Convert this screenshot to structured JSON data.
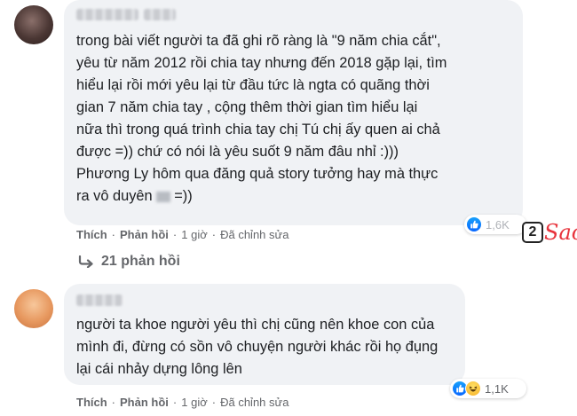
{
  "comments": [
    {
      "author": "",
      "text": "trong bài viết người ta đã ghi rõ ràng là \"9 năm chia cắt\",\nyêu từ năm 2012 rồi chia tay nhưng đến 2018 gặp lại, tìm\nhiểu lại rồi mới yêu lại từ đầu tức là ngta có quãng thời\ngian 7 năm chia tay , cộng thêm thời gian tìm hiểu lại\nnữa thì trong quá trình chia tay chị Tú chị ấy quen ai chả\nđược =)) chứ có nói là yêu suốt 9 năm đâu nhỉ :)))\nPhương Ly hôm qua đăng quả story tưởng hay mà thực\nra vô duyên",
      "text_tail": "=))",
      "like_label": "Thích",
      "reply_label": "Phản hồi",
      "time": "1 giờ",
      "edited": "Đã chỉnh sửa",
      "reaction_count": "1,6K"
    },
    {
      "author": "",
      "text": "người ta khoe người yêu thì chị cũng nên khoe con của\nmình đi, đừng có sồn vô chuyện người khác rồi họ đụng\nlại cái nhảy dựng lông lên",
      "like_label": "Thích",
      "reply_label": "Phản hồi",
      "time": "1 giờ",
      "edited": "Đã chỉnh sửa",
      "reaction_count": "1,1K"
    }
  ],
  "replies": {
    "label": "21 phản hồi"
  },
  "separator": "·",
  "watermark": {
    "box": "2",
    "text": "Sao",
    "color": "#e8343d"
  },
  "icons": {
    "like": "like-reaction-icon",
    "haha": "haha-reaction-icon",
    "reply_arrow": "reply-arrow-icon"
  },
  "colors": {
    "bubble": "#f0f2f5",
    "meta": "#65676b",
    "like_blue": "#0866ff"
  }
}
